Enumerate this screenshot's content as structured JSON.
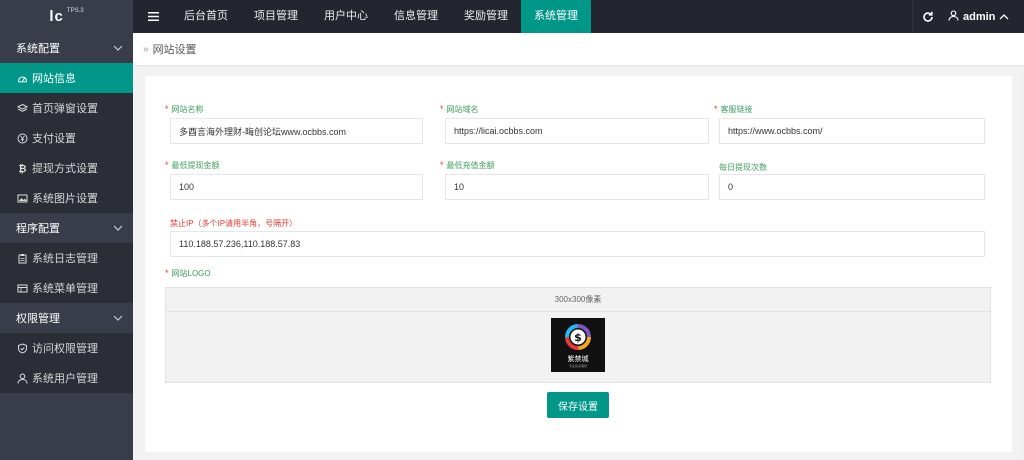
{
  "header": {
    "logo_text": "lc",
    "logo_version": "TPS.3",
    "nav": [
      {
        "label": "后台首页",
        "active": false
      },
      {
        "label": "项目管理",
        "active": false
      },
      {
        "label": "用户中心",
        "active": false
      },
      {
        "label": "信息管理",
        "active": false
      },
      {
        "label": "奖励管理",
        "active": false
      },
      {
        "label": "系统管理",
        "active": true
      }
    ],
    "user_name": "admin"
  },
  "sidebar": {
    "groups": [
      {
        "title": "系统配置",
        "items": [
          {
            "label": "网站信息",
            "icon": "dashboard-icon",
            "active": true
          },
          {
            "label": "首页弹窗设置",
            "icon": "layers-icon",
            "active": false
          },
          {
            "label": "支付设置",
            "icon": "yen-icon",
            "active": false
          },
          {
            "label": "提现方式设置",
            "icon": "bitcoin-icon",
            "active": false
          },
          {
            "label": "系统图片设置",
            "icon": "image-icon",
            "active": false
          }
        ]
      },
      {
        "title": "程序配置",
        "items": [
          {
            "label": "系统日志管理",
            "icon": "clipboard-icon",
            "active": false
          },
          {
            "label": "系统菜单管理",
            "icon": "table-icon",
            "active": false
          }
        ]
      },
      {
        "title": "权限管理",
        "items": [
          {
            "label": "访问权限管理",
            "icon": "shield-icon",
            "active": false
          },
          {
            "label": "系统用户管理",
            "icon": "user-icon",
            "active": false
          }
        ]
      }
    ]
  },
  "breadcrumb": {
    "sep": "»",
    "current": "网站设置"
  },
  "form": {
    "site_name": {
      "label": "网站名称",
      "required": true,
      "value": "多酉言海外理财-晦创论坛www.ocbbs.com"
    },
    "site_domain": {
      "label": "网站域名",
      "required": true,
      "value": "https://licai.ocbbs.com"
    },
    "service_link": {
      "label": "客服链接",
      "required": true,
      "value": "https://www.ocbbs.com/"
    },
    "min_withdraw": {
      "label": "最低提现金额",
      "required": true,
      "value": "100"
    },
    "min_recharge": {
      "label": "最低充值金额",
      "required": true,
      "value": "10"
    },
    "daily_withdraw_times": {
      "label": "每日提现次数",
      "required": false,
      "value": "0"
    },
    "banned_ip": {
      "label": "禁止IP（多个IP请用半角，号隔开）",
      "required": false,
      "value": "110.188.57.236,110.188.57.83"
    },
    "site_logo": {
      "label": "网站LOGO",
      "required": true,
      "size_hint": "300x300像素",
      "logo_brand": "紫禁城",
      "logo_slogan": "专业投资理财"
    },
    "save_label": "保存设置"
  },
  "colors": {
    "accent": "#009688",
    "required": "#e53935",
    "label": "#3c9e5c",
    "topbar": "#23262e",
    "sidebar": "#393d49"
  }
}
